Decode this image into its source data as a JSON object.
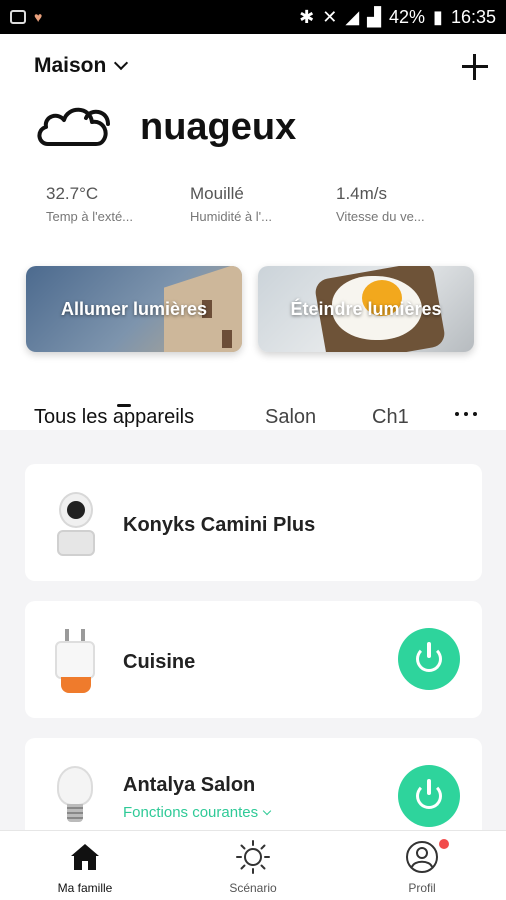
{
  "statusbar": {
    "battery": "42%",
    "time": "16:35"
  },
  "header": {
    "home_name": "Maison",
    "add_icon": "plus-icon"
  },
  "weather": {
    "condition": "nuageux",
    "icon": "cloud-icon",
    "stats": [
      {
        "value": "32.7°C",
        "label": "Temp à l'exté..."
      },
      {
        "value": "Mouillé",
        "label": "Humidité à l'..."
      },
      {
        "value": "1.4m/s",
        "label": "Vitesse du ve..."
      }
    ]
  },
  "scenes": [
    {
      "label": "Allumer lumières"
    },
    {
      "label": "Éteindre lumières"
    }
  ],
  "tabs": [
    {
      "label": "Tous les appareils"
    },
    {
      "label": "Salon"
    },
    {
      "label": "Ch1"
    }
  ],
  "devices": [
    {
      "name": "Konyks Camini Plus",
      "icon": "camera-icon"
    },
    {
      "name": "Cuisine",
      "icon": "smart-plug-icon",
      "power": true
    },
    {
      "name": "Antalya Salon",
      "icon": "bulb-icon",
      "subtitle": "Fonctions courantes",
      "power": true
    }
  ],
  "nav": [
    {
      "label": "Ma famille",
      "icon": "home-icon"
    },
    {
      "label": "Scénario",
      "icon": "sun-icon"
    },
    {
      "label": "Profil",
      "icon": "profile-icon"
    }
  ],
  "colors": {
    "accent": "#2ed49c",
    "notification": "#f24b4b"
  }
}
